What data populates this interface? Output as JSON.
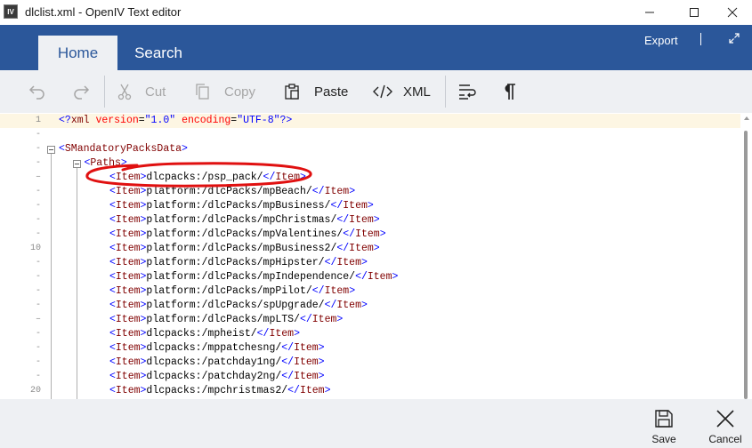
{
  "window": {
    "title": "dlclist.xml - OpenIV Text editor",
    "icon_text": "IV"
  },
  "ribbon": {
    "tabs": [
      {
        "label": "Home",
        "active": true
      },
      {
        "label": "Search",
        "active": false
      }
    ],
    "export_label": "Export"
  },
  "toolbar": {
    "cut_label": "Cut",
    "copy_label": "Copy",
    "paste_label": "Paste",
    "xml_label": "XML"
  },
  "editor": {
    "lines": [
      {
        "n": "1",
        "kind": "decl",
        "indent": 0,
        "text": "<?xml version=\"1.0\" encoding=\"UTF-8\"?>"
      },
      {
        "n": "-",
        "kind": "blank",
        "indent": 0,
        "text": ""
      },
      {
        "n": "-",
        "kind": "open",
        "indent": 0,
        "tag": "SMandatoryPacksData"
      },
      {
        "n": "-",
        "kind": "open",
        "indent": 1,
        "tag": "Paths"
      },
      {
        "n": "–",
        "kind": "item",
        "indent": 2,
        "value": "dlcpacks:/psp_pack/"
      },
      {
        "n": "-",
        "kind": "item",
        "indent": 2,
        "value": "platform:/dlcPacks/mpBeach/"
      },
      {
        "n": "-",
        "kind": "item",
        "indent": 2,
        "value": "platform:/dlcPacks/mpBusiness/"
      },
      {
        "n": "-",
        "kind": "item",
        "indent": 2,
        "value": "platform:/dlcPacks/mpChristmas/"
      },
      {
        "n": "-",
        "kind": "item",
        "indent": 2,
        "value": "platform:/dlcPacks/mpValentines/"
      },
      {
        "n": "10",
        "kind": "item",
        "indent": 2,
        "value": "platform:/dlcPacks/mpBusiness2/"
      },
      {
        "n": "-",
        "kind": "item",
        "indent": 2,
        "value": "platform:/dlcPacks/mpHipster/"
      },
      {
        "n": "-",
        "kind": "item",
        "indent": 2,
        "value": "platform:/dlcPacks/mpIndependence/"
      },
      {
        "n": "-",
        "kind": "item",
        "indent": 2,
        "value": "platform:/dlcPacks/mpPilot/"
      },
      {
        "n": "-",
        "kind": "item",
        "indent": 2,
        "value": "platform:/dlcPacks/spUpgrade/"
      },
      {
        "n": "–",
        "kind": "item",
        "indent": 2,
        "value": "platform:/dlcPacks/mpLTS/"
      },
      {
        "n": "-",
        "kind": "item",
        "indent": 2,
        "value": "dlcpacks:/mpheist/"
      },
      {
        "n": "-",
        "kind": "item",
        "indent": 2,
        "value": "dlcpacks:/mppatchesng/"
      },
      {
        "n": "-",
        "kind": "item",
        "indent": 2,
        "value": "dlcpacks:/patchday1ng/"
      },
      {
        "n": "-",
        "kind": "item",
        "indent": 2,
        "value": "dlcpacks:/patchday2ng/"
      },
      {
        "n": "20",
        "kind": "item",
        "indent": 2,
        "value": "dlcpacks:/mpchristmas2/"
      }
    ]
  },
  "bottombar": {
    "save_label": "Save",
    "cancel_label": "Cancel"
  },
  "colors": {
    "ribbon_blue": "#2b579a",
    "toolbar_bg": "#eef0f3",
    "annotation_red": "#e01010"
  }
}
